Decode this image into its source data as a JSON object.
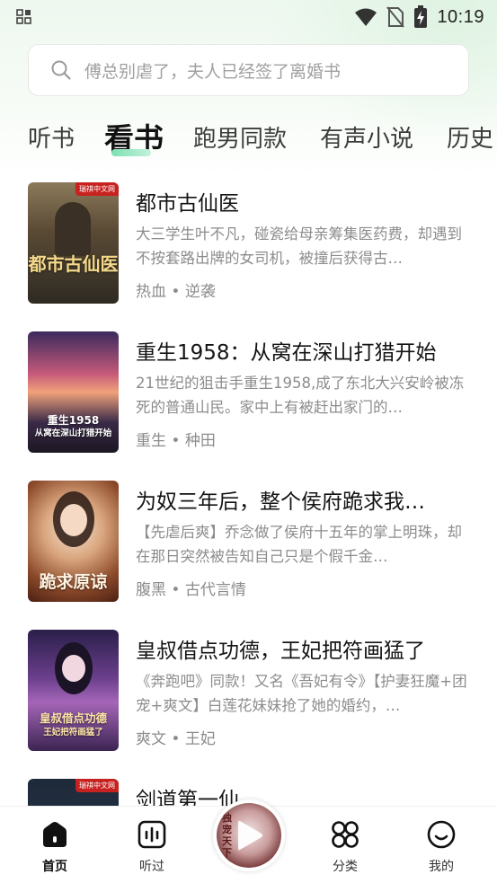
{
  "status_bar": {
    "time": "10:19"
  },
  "search": {
    "placeholder": "傅总别虐了，夫人已经签了离婚书"
  },
  "tabs": [
    {
      "label": "听书",
      "active": false
    },
    {
      "label": "看书",
      "active": true
    },
    {
      "label": "跑男同款",
      "active": false
    },
    {
      "label": "有声小说",
      "active": false
    },
    {
      "label": "历史",
      "active": false
    }
  ],
  "books": [
    {
      "title": "都市古仙医",
      "description": "大三学生叶不凡，碰瓷给母亲筹集医药费，却遇到不按套路出牌的女司机，被撞后获得古…",
      "tags": "热血 • 逆袭",
      "cover": {
        "badge": "瑞祺中文网",
        "text": "都市古仙医"
      }
    },
    {
      "title": "重生1958：从窝在深山打猎开始",
      "description": "21世纪的狙击手重生1958,成了东北大兴安岭被冻死的普通山民。家中上有被赶出家门的…",
      "tags": "重生 • 种田",
      "cover": {
        "text_line1": "重生1958",
        "text_line2": "从窝在深山打猎开始"
      }
    },
    {
      "title": "为奴三年后，整个侯府跪求我…",
      "description": "【先虐后爽】乔念做了侯府十五年的掌上明珠，却在那日突然被告知自己只是个假千金…",
      "tags": "腹黑 • 古代言情",
      "cover": {
        "text": "跪求原谅"
      }
    },
    {
      "title": "皇叔借点功德，王妃把符画猛了",
      "description": "《奔跑吧》同款！又名《吾妃有令》【护妻狂魔+团宠+爽文】白莲花妹妹抢了她的婚约，…",
      "tags": "爽文 • 王妃",
      "cover": {
        "text_line1": "皇叔借点功德",
        "text_line2": "王妃把符画猛了"
      }
    },
    {
      "title": "剑道第一仙",
      "description": "",
      "tags": "",
      "cover": {
        "badge": "瑞祺中文网"
      }
    }
  ],
  "bottom_nav": [
    {
      "label": "首页",
      "icon": "home-icon",
      "active": true
    },
    {
      "label": "听过",
      "icon": "audio-icon",
      "active": false
    },
    {
      "label": "分类",
      "icon": "category-icon",
      "active": false
    },
    {
      "label": "我的",
      "icon": "profile-icon",
      "active": false
    }
  ],
  "player": {
    "cover_text": "独宠天下"
  },
  "colors": {
    "accent_green": "#7be0b4",
    "text_primary": "#141414",
    "text_secondary": "#8c8c8c"
  }
}
